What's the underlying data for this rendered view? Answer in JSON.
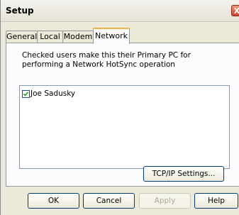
{
  "window": {
    "title": "Setup",
    "close_symbol": "X"
  },
  "tabs": [
    {
      "label": "General",
      "active": false
    },
    {
      "label": "Local",
      "active": false
    },
    {
      "label": "Modem",
      "active": false
    },
    {
      "label": "Network",
      "active": true
    }
  ],
  "network": {
    "description": "Checked users make this their Primary PC for performing a Network HotSync operation",
    "users": [
      {
        "name": "Joe Sadusky",
        "checked": true
      }
    ],
    "tcpip_button": "TCP/IP Settings..."
  },
  "buttons": {
    "ok": "OK",
    "cancel": "Cancel",
    "apply": "Apply",
    "help": "Help"
  },
  "icons": {
    "close": "close-icon",
    "checkmark": "checkmark-icon"
  }
}
